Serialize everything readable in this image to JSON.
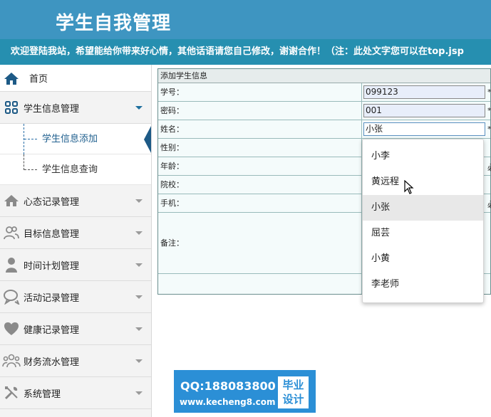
{
  "header": {
    "title": "学生自我管理"
  },
  "marquee": {
    "text": "欢迎登陆我站，希望能给你带来好心情，其他话语请您自己修改，谢谢合作！（注：此处文字您可以在top.jsp"
  },
  "sidebar": {
    "home": {
      "label": "首页",
      "icon": "home-icon"
    },
    "items": [
      {
        "label": "学生信息管理",
        "icon": "grid-icon",
        "open": true,
        "children": [
          {
            "label": "学生信息添加",
            "active": true
          },
          {
            "label": "学生信息查询"
          }
        ]
      },
      {
        "label": "心态记录管理",
        "icon": "house-icon"
      },
      {
        "label": "目标信息管理",
        "icon": "users-icon"
      },
      {
        "label": "时间计划管理",
        "icon": "person-icon"
      },
      {
        "label": "活动记录管理",
        "icon": "chat-icon"
      },
      {
        "label": "健康记录管理",
        "icon": "heart-icon"
      },
      {
        "label": "财务流水管理",
        "icon": "group-icon"
      },
      {
        "label": "系统管理",
        "icon": "tools-icon"
      }
    ]
  },
  "form": {
    "caption": "添加学生信息",
    "fields": [
      {
        "label": "学号：",
        "value": "099123",
        "required": "*"
      },
      {
        "label": "密码：",
        "value": "001",
        "required": "*"
      },
      {
        "label": "姓名：",
        "value": "小张",
        "required": "*"
      },
      {
        "label": "性别："
      },
      {
        "label": "年龄：",
        "extra": "必"
      },
      {
        "label": "院校："
      },
      {
        "label": "手机：",
        "extra": "必"
      },
      {
        "label": "备注："
      }
    ]
  },
  "dropdown": {
    "options": [
      "小李",
      "黄远程",
      "小张",
      "屈芸",
      "小黄",
      "李老师"
    ],
    "hovered_index": 2
  },
  "watermark": {
    "qq": "QQ:188083800",
    "url": "www.kecheng8.com",
    "badge_line1": "毕业",
    "badge_line2": "设计"
  },
  "colors": {
    "header": "#3e95c1",
    "marquee": "#268fb0",
    "accent": "#1d5a86"
  }
}
